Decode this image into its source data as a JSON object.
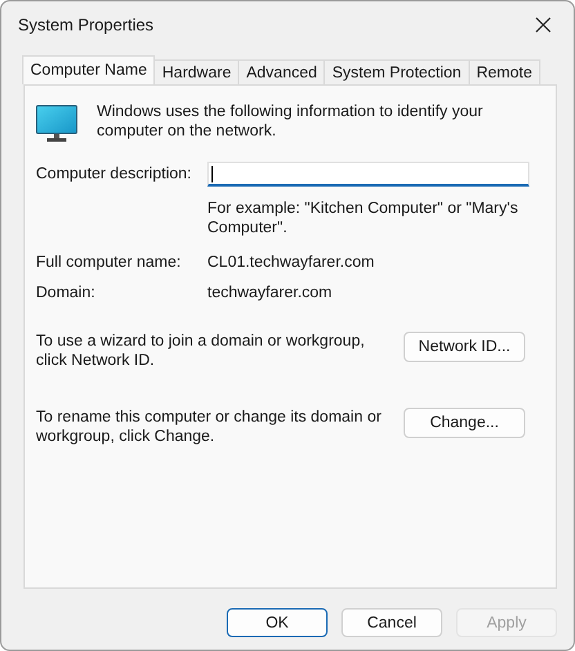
{
  "window": {
    "title": "System Properties"
  },
  "tabs": [
    {
      "label": "Computer Name",
      "selected": true
    },
    {
      "label": "Hardware",
      "selected": false
    },
    {
      "label": "Advanced",
      "selected": false
    },
    {
      "label": "System Protection",
      "selected": false
    },
    {
      "label": "Remote",
      "selected": false
    }
  ],
  "intro": "Windows uses the following information to identify your computer on the network.",
  "description": {
    "label": "Computer description:",
    "focused": true,
    "hint": "For example: \"Kitchen Computer\" or \"Mary's Computer\"."
  },
  "info": [
    {
      "label": "Full computer name:",
      "value": "CL01.techwayfarer.com"
    },
    {
      "label": "Domain:",
      "value": "techwayfarer.com"
    }
  ],
  "actions": [
    {
      "text": "To use a wizard to join a domain or workgroup, click Network ID.",
      "button": "Network ID..."
    },
    {
      "text": "To rename this computer or change its domain or workgroup, click Change.",
      "button": "Change..."
    }
  ],
  "buttons": [
    {
      "label": "OK",
      "default": true,
      "disabled": false
    },
    {
      "label": "Cancel",
      "default": false,
      "disabled": false
    },
    {
      "label": "Apply",
      "default": false,
      "disabled": true
    }
  ]
}
